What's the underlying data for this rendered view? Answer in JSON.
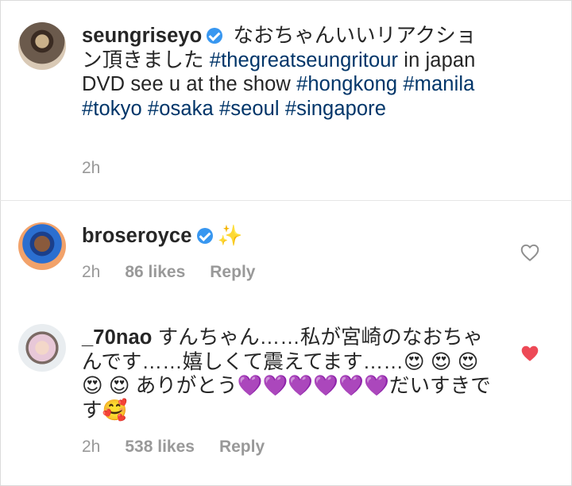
{
  "caption": {
    "username": "seungriseyo",
    "text_before": " なおちゃんいいリアクション頂きました ",
    "hashtag1": "#thegreatseungritour",
    "text_mid": " in japan DVD see u at the show ",
    "hashtag2": "#hongkong",
    "hashtag3": "#manila",
    "hashtag4": "#tokyo",
    "hashtag5": "#osaka",
    "hashtag6": "#seoul",
    "hashtag7": "#singapore",
    "time": "2h"
  },
  "comments": [
    {
      "username": "broseroyce",
      "text": "✨",
      "time": "2h",
      "likes": "86 likes",
      "reply": "Reply",
      "liked": false
    },
    {
      "username": "_70nao",
      "text": "すんちゃん……私が宮崎のなおちゃんです……嬉しくて震えてます……😍 😍 😍 😍 😍 ありがとう💜💜💜💜💜💜だいすきです🥰",
      "time": "2h",
      "likes": "538 likes",
      "reply": "Reply",
      "liked": true
    }
  ],
  "colors": {
    "hashtag": "#003569",
    "verified": "#3897f0",
    "heart_active": "#ed4956",
    "meta": "#999999"
  },
  "icons": [
    "verified-badge-icon",
    "heart-outline-icon",
    "heart-filled-icon"
  ]
}
